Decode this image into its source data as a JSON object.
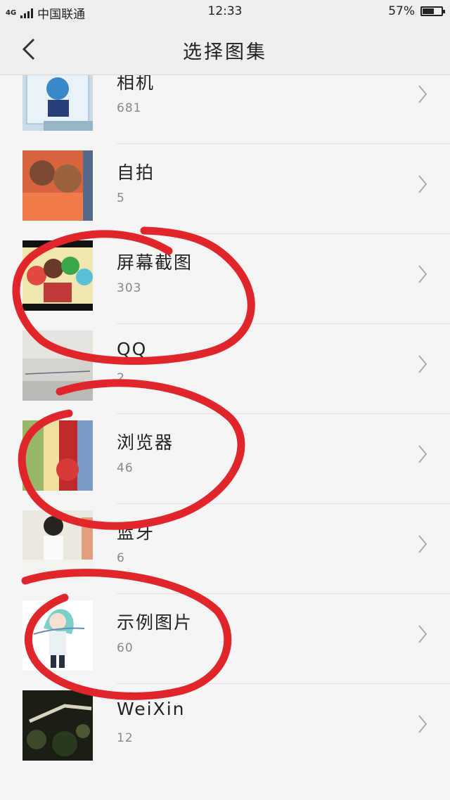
{
  "status_bar": {
    "network": "4G",
    "carrier": "中国联通",
    "time": "12:33",
    "battery": "57%",
    "battery_level": 0.57
  },
  "header": {
    "title": "选择图集"
  },
  "albums": [
    {
      "name": "相机",
      "count": "681"
    },
    {
      "name": "自拍",
      "count": "5"
    },
    {
      "name": "屏幕截图",
      "count": "303"
    },
    {
      "name": "QQ",
      "count": "2"
    },
    {
      "name": "浏览器",
      "count": "46"
    },
    {
      "name": "蓝牙",
      "count": "6"
    },
    {
      "name": "示例图片",
      "count": "60"
    },
    {
      "name": "WeiXin",
      "count": "12"
    }
  ],
  "colors": {
    "annotation": "#e0262b",
    "background": "#f5f5f5",
    "header": "#eeeeee"
  }
}
